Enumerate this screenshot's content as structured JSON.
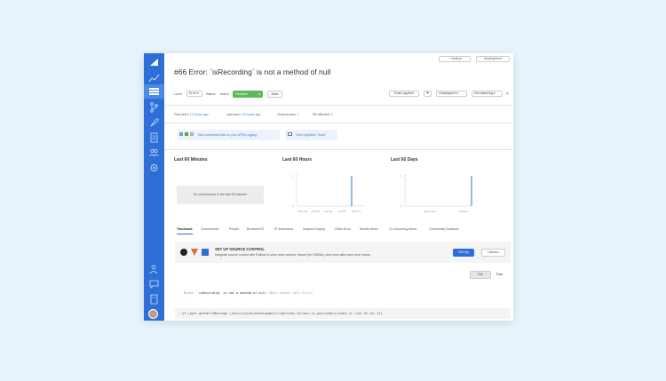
{
  "header": {
    "btn_nodejs": "☆ Node.js",
    "btn_env": "development",
    "title": "#66 Error: `isRecording` is not a method of null"
  },
  "controls": {
    "level_label": "Level:",
    "level_value": "Error",
    "status_label": "Status:",
    "status_prefix": "Active",
    "status_value": "Resolve",
    "mute": "Mute",
    "rules_applied": "Rules Applied",
    "assign": "Unassigned",
    "watch": "Not watching",
    "close": "×"
  },
  "stats": {
    "first_seen_label": "First seen:",
    "first_seen_value": "19 hours ago",
    "last_seen_label": "Last seen:",
    "last_seen_value": "19 hours ago",
    "occurrences_label": "Occurrences:",
    "occurrences_value": "1",
    "ips_label": "IPs affected:",
    "ips_value": "1"
  },
  "integration": {
    "text": "Add contextual links to your APM/Logging",
    "lightstep": "View Lightstep Trace"
  },
  "charts": {
    "minutes_title": "Last 60 Minutes",
    "no_occ": "No occurrences in the last 60 minutes",
    "hours_title": "Last 60 Hours",
    "days_title": "Last 60 Days"
  },
  "chart_data": [
    {
      "type": "bar",
      "title": "Last 60 Hours",
      "xtick_labels": [
        "Mon 06",
        "12 PM",
        "Tue 06",
        "12 PM",
        "Wed 07"
      ],
      "ylim": [
        0,
        1
      ],
      "ytick_labels": [
        "0",
        "1"
      ],
      "values_note_x_position": 0.82,
      "spike": 1
    },
    {
      "type": "bar",
      "title": "Last 60 Days",
      "xtick_labels": [
        "September",
        "October"
      ],
      "ylim": [
        0,
        1
      ],
      "ytick_labels": [
        "0",
        "1"
      ],
      "spike": 1
    }
  ],
  "tabs": [
    "Traceback",
    "Occurrences",
    "People",
    "Browser/OS",
    "IP Addresses",
    "Suspect Deploy",
    "Other Envs",
    "Similar Items",
    "Co-Occurring Items",
    "Community Solutions"
  ],
  "source": {
    "title": "SET UP SOURCE CONTROL",
    "desc": "Integrate source control with Rollbar to view code context, blame (for GitHub), and more with each error frame.",
    "setup": "Set Up",
    "dismiss": "Dismiss"
  },
  "trace": {
    "full": "Full",
    "raw": "Raw",
    "error_prefix": "Error:",
    "error_msg": "`isRecording` is not a method of null",
    "error_more": "(Most recent call first)",
    "frame": "at Layer.getHelloMessage (/Users/kylan/Development/lightstep-rollbar-js-poc/nodejs/index.js line 55 col 12)"
  }
}
